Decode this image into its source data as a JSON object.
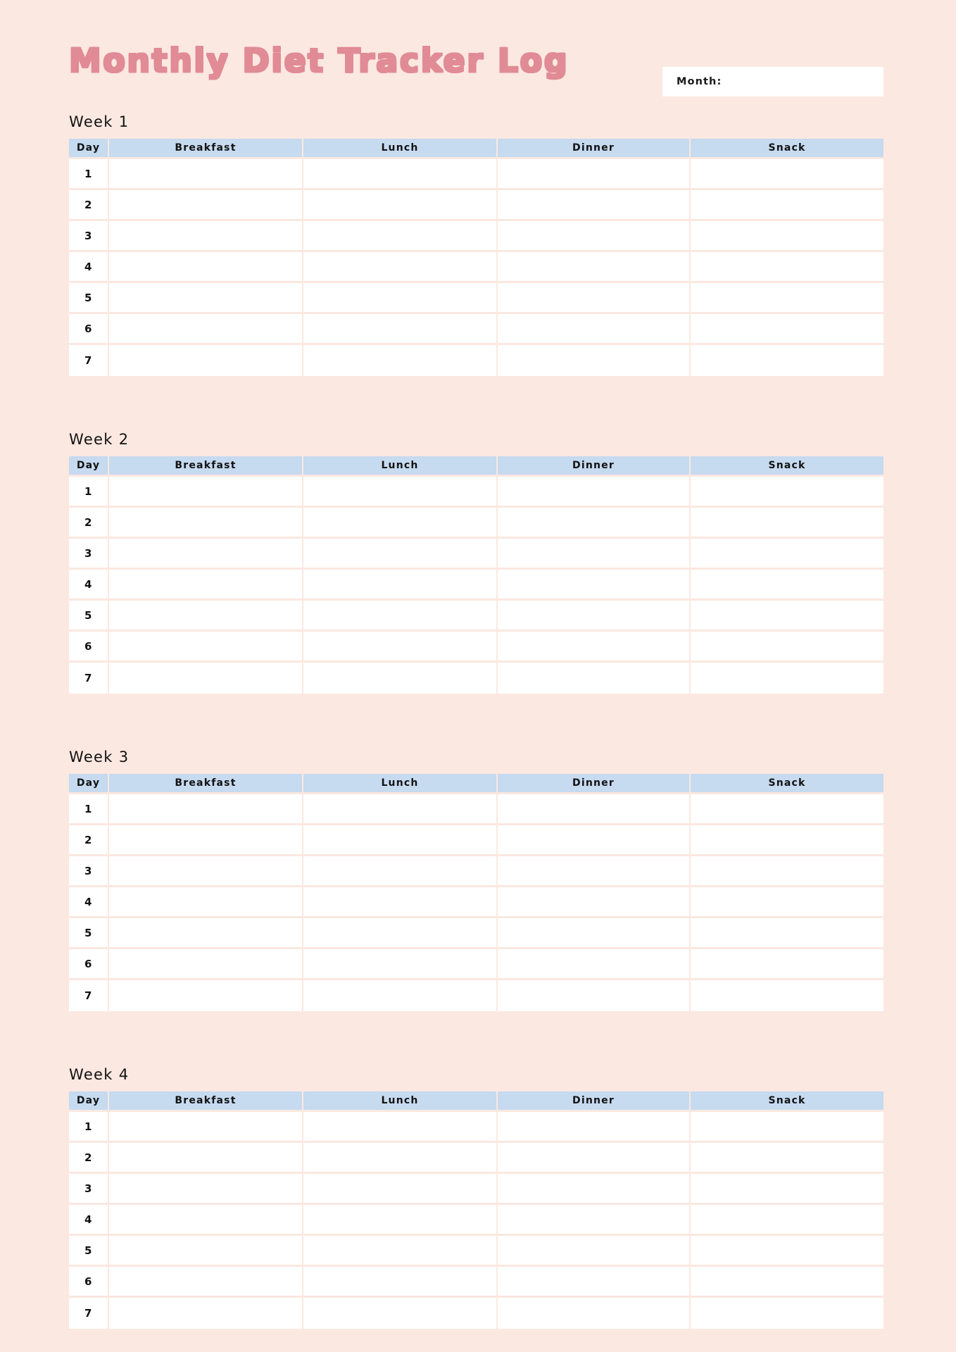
{
  "document": {
    "title": "Monthly Diet Tracker Log",
    "background_color": "#fbe8e0",
    "title_color": "#e08b96",
    "header_row_color": "#c6daf0",
    "cell_color": "#ffffff"
  },
  "month_field": {
    "label": "Month:",
    "value": "",
    "placeholder": ""
  },
  "columns": [
    "Day",
    "Breakfast",
    "Lunch",
    "Dinner",
    "Snack"
  ],
  "weeks": [
    {
      "title": "Week 1",
      "rows": [
        {
          "day": "1",
          "breakfast": "",
          "lunch": "",
          "dinner": "",
          "snack": ""
        },
        {
          "day": "2",
          "breakfast": "",
          "lunch": "",
          "dinner": "",
          "snack": ""
        },
        {
          "day": "3",
          "breakfast": "",
          "lunch": "",
          "dinner": "",
          "snack": ""
        },
        {
          "day": "4",
          "breakfast": "",
          "lunch": "",
          "dinner": "",
          "snack": ""
        },
        {
          "day": "5",
          "breakfast": "",
          "lunch": "",
          "dinner": "",
          "snack": ""
        },
        {
          "day": "6",
          "breakfast": "",
          "lunch": "",
          "dinner": "",
          "snack": ""
        },
        {
          "day": "7",
          "breakfast": "",
          "lunch": "",
          "dinner": "",
          "snack": ""
        }
      ]
    },
    {
      "title": "Week 2",
      "rows": [
        {
          "day": "1",
          "breakfast": "",
          "lunch": "",
          "dinner": "",
          "snack": ""
        },
        {
          "day": "2",
          "breakfast": "",
          "lunch": "",
          "dinner": "",
          "snack": ""
        },
        {
          "day": "3",
          "breakfast": "",
          "lunch": "",
          "dinner": "",
          "snack": ""
        },
        {
          "day": "4",
          "breakfast": "",
          "lunch": "",
          "dinner": "",
          "snack": ""
        },
        {
          "day": "5",
          "breakfast": "",
          "lunch": "",
          "dinner": "",
          "snack": ""
        },
        {
          "day": "6",
          "breakfast": "",
          "lunch": "",
          "dinner": "",
          "snack": ""
        },
        {
          "day": "7",
          "breakfast": "",
          "lunch": "",
          "dinner": "",
          "snack": ""
        }
      ]
    },
    {
      "title": "Week 3",
      "rows": [
        {
          "day": "1",
          "breakfast": "",
          "lunch": "",
          "dinner": "",
          "snack": ""
        },
        {
          "day": "2",
          "breakfast": "",
          "lunch": "",
          "dinner": "",
          "snack": ""
        },
        {
          "day": "3",
          "breakfast": "",
          "lunch": "",
          "dinner": "",
          "snack": ""
        },
        {
          "day": "4",
          "breakfast": "",
          "lunch": "",
          "dinner": "",
          "snack": ""
        },
        {
          "day": "5",
          "breakfast": "",
          "lunch": "",
          "dinner": "",
          "snack": ""
        },
        {
          "day": "6",
          "breakfast": "",
          "lunch": "",
          "dinner": "",
          "snack": ""
        },
        {
          "day": "7",
          "breakfast": "",
          "lunch": "",
          "dinner": "",
          "snack": ""
        }
      ]
    },
    {
      "title": "Week 4",
      "rows": [
        {
          "day": "1",
          "breakfast": "",
          "lunch": "",
          "dinner": "",
          "snack": ""
        },
        {
          "day": "2",
          "breakfast": "",
          "lunch": "",
          "dinner": "",
          "snack": ""
        },
        {
          "day": "3",
          "breakfast": "",
          "lunch": "",
          "dinner": "",
          "snack": ""
        },
        {
          "day": "4",
          "breakfast": "",
          "lunch": "",
          "dinner": "",
          "snack": ""
        },
        {
          "day": "5",
          "breakfast": "",
          "lunch": "",
          "dinner": "",
          "snack": ""
        },
        {
          "day": "6",
          "breakfast": "",
          "lunch": "",
          "dinner": "",
          "snack": ""
        },
        {
          "day": "7",
          "breakfast": "",
          "lunch": "",
          "dinner": "",
          "snack": ""
        }
      ]
    }
  ]
}
